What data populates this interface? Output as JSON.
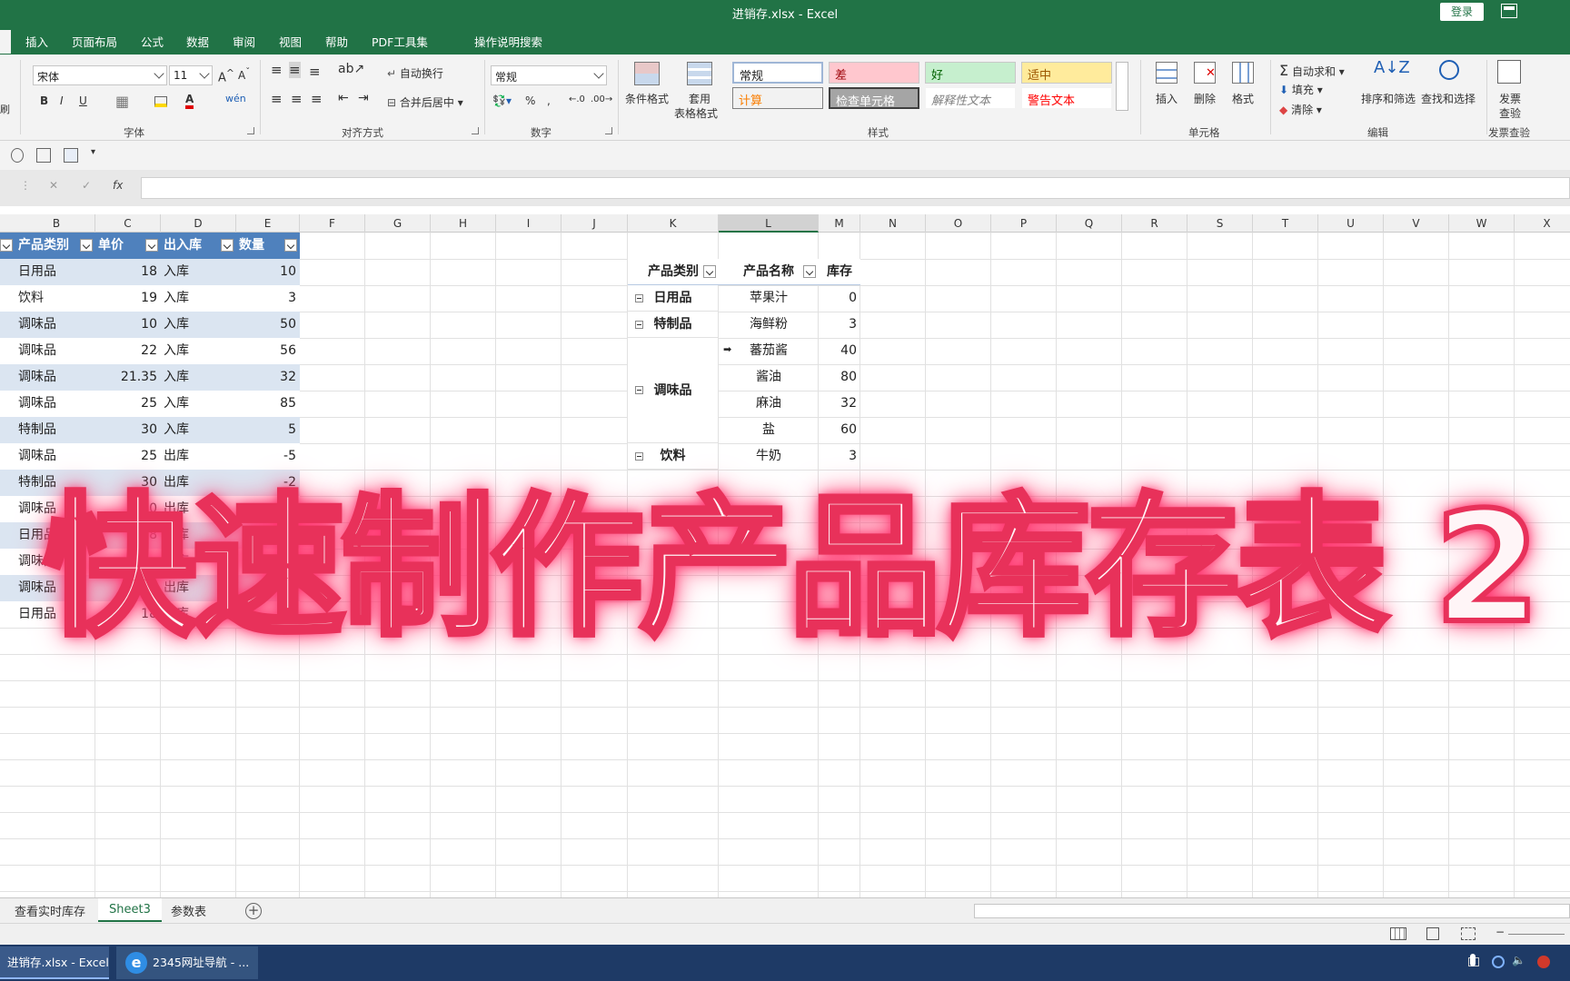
{
  "window": {
    "title": "进销存.xlsx  -  Excel",
    "login": "登录"
  },
  "tabs": [
    "插入",
    "页面布局",
    "公式",
    "数据",
    "审阅",
    "视图",
    "帮助",
    "PDF工具集",
    "操作说明搜索"
  ],
  "ribbon": {
    "font_name": "宋体",
    "font_size": "11",
    "wrap_text": "自动换行",
    "merge_center": "合并后居中",
    "number_format": "常规",
    "conditional_format": "条件格式",
    "table_format_1": "套用",
    "table_format_2": "表格格式",
    "styles": {
      "normal": "常规",
      "bad": "差",
      "good": "好",
      "neutral": "适中",
      "calc": "计算",
      "check": "检查单元格",
      "explain": "解释性文本",
      "warning": "警告文本"
    },
    "insert": "插入",
    "delete": "删除",
    "format": "格式",
    "autosum": "自动求和",
    "fill": "填充",
    "clear": "清除",
    "sort_filter": "排序和筛选",
    "find_select": "查找和选择",
    "invoice_1": "发票",
    "invoice_2": "查验",
    "groups": {
      "font": "字体",
      "align": "对齐方式",
      "number": "数字",
      "styles": "样式",
      "cells": "单元格",
      "edit": "编辑",
      "invoice": "发票查验"
    },
    "left_clip": "刷"
  },
  "formula_bar": {
    "fx": "fx",
    "cancel": "✕",
    "confirm": "✓"
  },
  "columns": [
    "B",
    "C",
    "D",
    "E",
    "F",
    "G",
    "H",
    "I",
    "J",
    "K",
    "L",
    "M",
    "N",
    "O",
    "P",
    "Q",
    "R",
    "S",
    "T",
    "U",
    "V",
    "W",
    "X"
  ],
  "table": {
    "headers": [
      "产品类别",
      "单价",
      "出入库",
      "数量"
    ],
    "rows": [
      [
        "日用品",
        "18",
        "入库",
        "10"
      ],
      [
        "饮料",
        "19",
        "入库",
        "3"
      ],
      [
        "调味品",
        "10",
        "入库",
        "50"
      ],
      [
        "调味品",
        "22",
        "入库",
        "56"
      ],
      [
        "调味品",
        "21.35",
        "入库",
        "32"
      ],
      [
        "调味品",
        "25",
        "入库",
        "85"
      ],
      [
        "特制品",
        "30",
        "入库",
        "5"
      ],
      [
        "调味品",
        "25",
        "出库",
        "-5"
      ],
      [
        "特制品",
        "30",
        "出库",
        "-2"
      ],
      [
        "调味品",
        "10",
        "出库",
        ""
      ],
      [
        "日用品",
        "18",
        "出库",
        ""
      ],
      [
        "调味品",
        "",
        "出库",
        ""
      ],
      [
        "调味品",
        "",
        "出库",
        ""
      ],
      [
        "日用品",
        "18",
        "出库",
        ""
      ]
    ]
  },
  "pivot": {
    "headers": [
      "产品类别",
      "产品名称",
      "库存"
    ],
    "groups": [
      {
        "category": "日用品",
        "items": [
          [
            "苹果汁",
            "0"
          ]
        ]
      },
      {
        "category": "特制品",
        "items": [
          [
            "海鲜粉",
            "3"
          ]
        ]
      },
      {
        "category": "调味品",
        "items": [
          [
            "蕃茄酱",
            "40"
          ],
          [
            "酱油",
            "80"
          ],
          [
            "麻油",
            "32"
          ],
          [
            "盐",
            "60"
          ]
        ]
      },
      {
        "category": "饮料",
        "items": [
          [
            "牛奶",
            "3"
          ]
        ]
      }
    ]
  },
  "overlay": {
    "title": "快速制作产品库存表 2"
  },
  "sheets": [
    "查看实时库存",
    "Sheet3",
    "参数表"
  ],
  "taskbar": {
    "excel": "进销存.xlsx - Excel",
    "browser": "2345网址导航 - ..."
  }
}
